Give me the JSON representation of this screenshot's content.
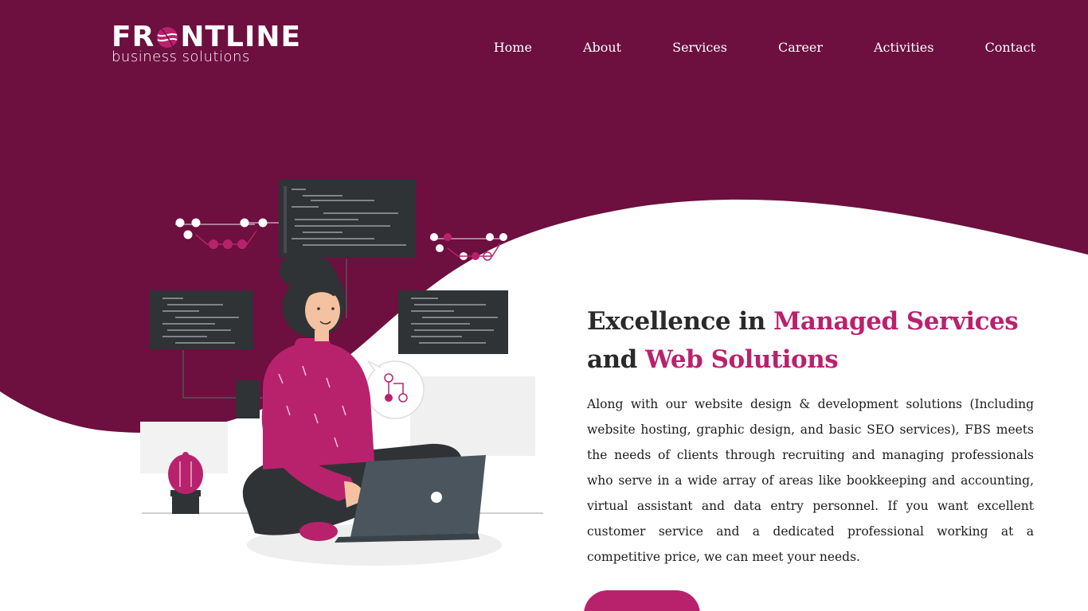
{
  "colors": {
    "brand_dark": "#6d0f3f",
    "accent": "#b8226d",
    "text": "#2a2a2a",
    "background": "#ffffff"
  },
  "logo": {
    "main_before": "FR",
    "main_after": "NTLINE",
    "sub": "business solutions"
  },
  "nav": {
    "items": [
      {
        "label": "Home"
      },
      {
        "label": "About"
      },
      {
        "label": "Services"
      },
      {
        "label": "Career"
      },
      {
        "label": "Activities"
      },
      {
        "label": "Contact"
      }
    ]
  },
  "hero": {
    "headline": {
      "part1": "Excellence in ",
      "accent1": "Managed Services",
      "part2": "and ",
      "accent2": "Web Solutions"
    },
    "description": "Along with our website design & development solutions (Including website hosting, graphic design, and basic SEO services), FBS meets the needs of clients through recruiting and managing professionals who serve in a wide array of areas like bookkeeping and accounting, virtual assistant and data entry personnel. If you want excellent customer service and a dedicated professional working at a competitive price, we can meet your needs.",
    "cta_label": ""
  }
}
